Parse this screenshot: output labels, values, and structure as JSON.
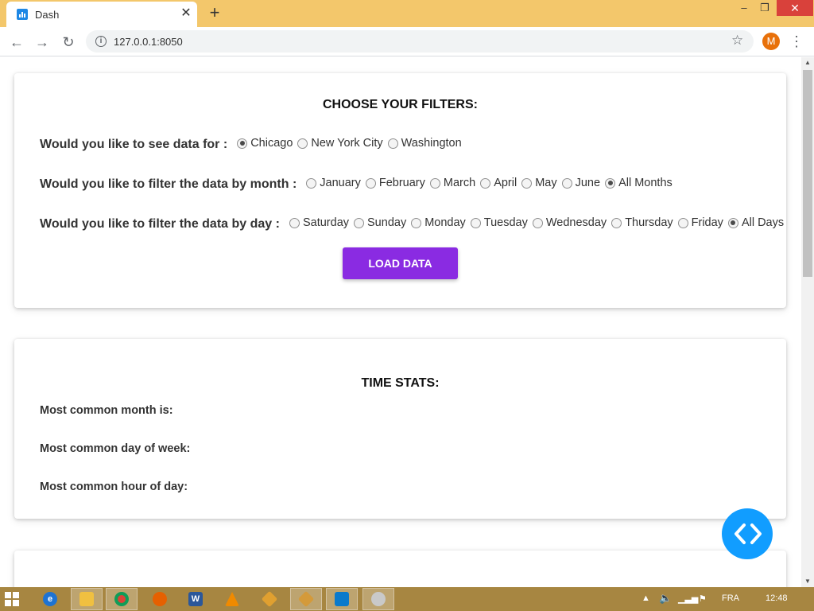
{
  "browser": {
    "tab_title": "Dash",
    "url": "127.0.0.1:8050",
    "avatar_letter": "M",
    "close_tab_glyph": "✕",
    "new_tab_glyph": "+",
    "window_minimize": "–",
    "window_restore": "❐",
    "window_close": "✕"
  },
  "filters": {
    "title": "CHOOSE YOUR FILTERS:",
    "city": {
      "label": "Would you like to see data for :",
      "options": [
        "Chicago",
        "New York City",
        "Washington"
      ],
      "selected": "Chicago"
    },
    "month": {
      "label": "Would you like to filter the data by month :",
      "options": [
        "January",
        "February",
        "March",
        "April",
        "May",
        "June",
        "All Months"
      ],
      "selected": "All Months"
    },
    "day": {
      "label": "Would you like to filter the data by day :",
      "options": [
        "Saturday",
        "Sunday",
        "Monday",
        "Tuesday",
        "Wednesday",
        "Thursday",
        "Friday",
        "All Days"
      ],
      "selected": "All Days"
    },
    "load_button": "LOAD DATA"
  },
  "time_stats": {
    "title": "TIME STATS:",
    "month_label": "Most common month is:",
    "day_label": "Most common day of week:",
    "hour_label": "Most common hour of day:"
  },
  "colors": {
    "accent_button": "#8a2be2",
    "fab": "#119dff",
    "titlebar": "#f3c76b",
    "taskbar": "#a78641"
  },
  "taskbar": {
    "language": "FRA",
    "time": "12:48"
  }
}
